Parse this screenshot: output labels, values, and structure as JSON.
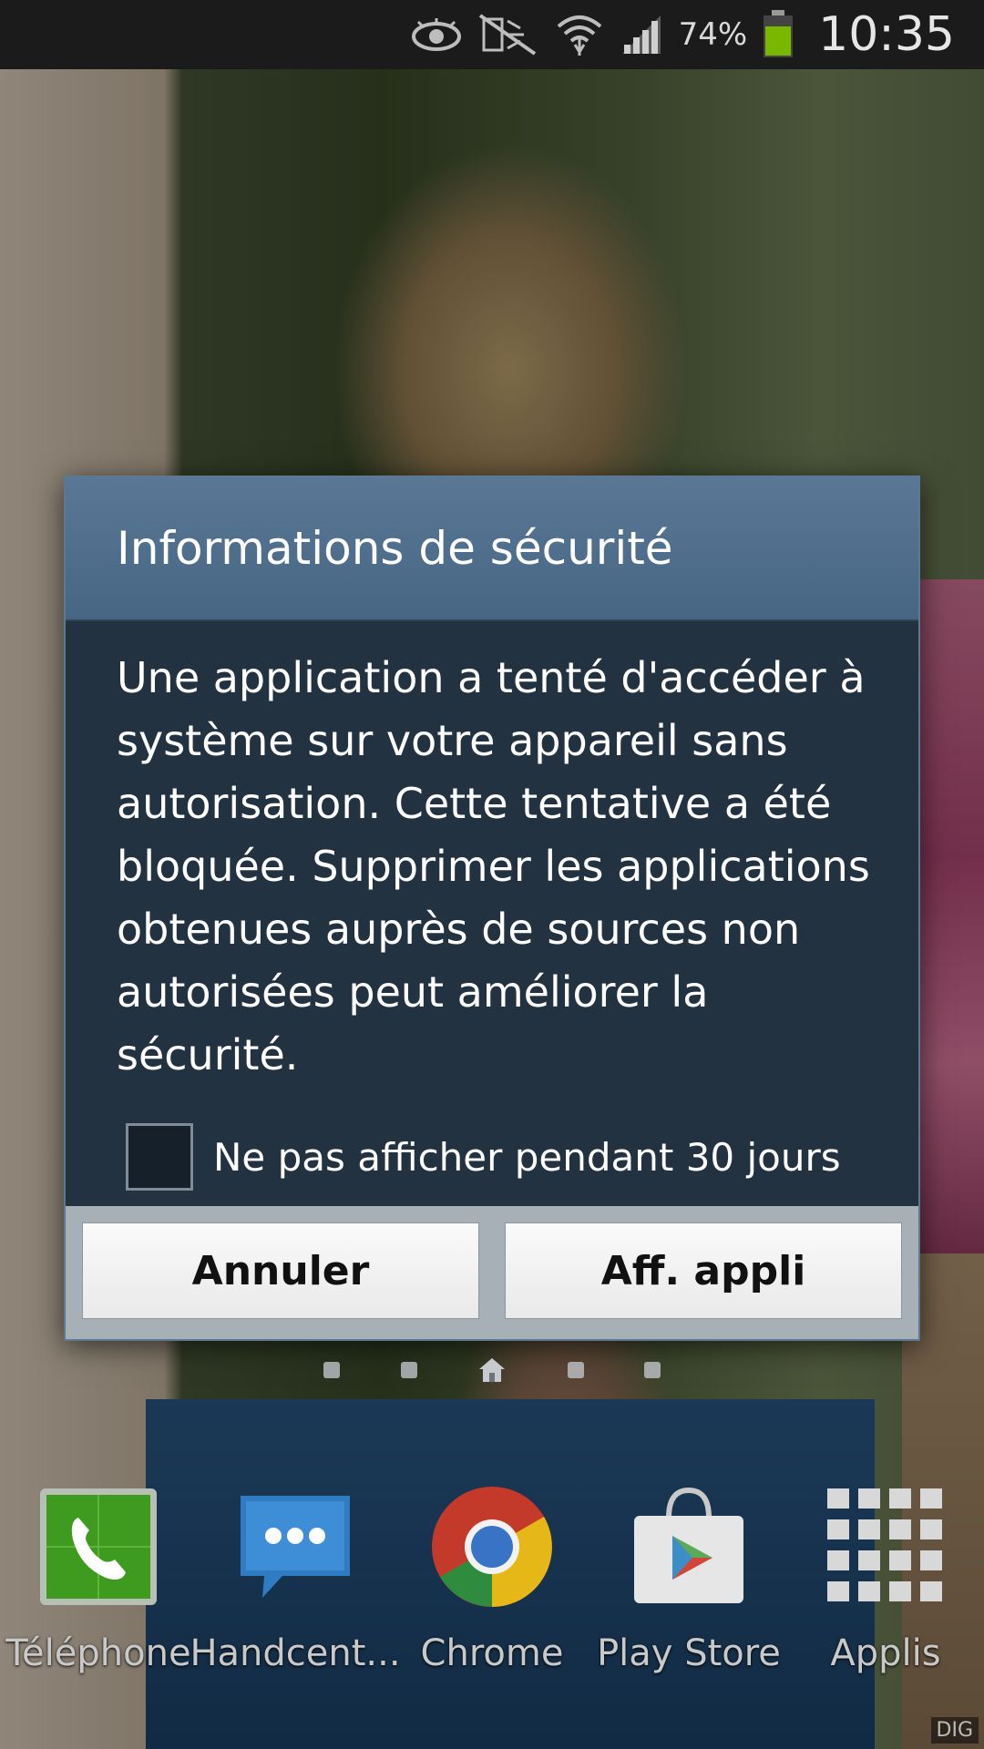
{
  "status_bar": {
    "battery_percent": "74%",
    "time": "10:35",
    "icons": [
      "eye-icon",
      "mute-icon",
      "wifi-icon",
      "signal-icon",
      "battery-icon"
    ],
    "battery_color": "#7ab800"
  },
  "dialog": {
    "title": "Informations de sécurité",
    "message": "Une application a tenté d'accéder à système sur votre appareil sans autorisation. Cette tentative a été bloquée. Supprimer les applications obtenues auprès de sources non autorisées peut améliorer la sécurité.",
    "checkbox_label": "Ne pas afficher pendant 30 jours",
    "checkbox_checked": false,
    "cancel_label": "Annuler",
    "confirm_label": "Aff. appli",
    "header_color": "#4b6a88",
    "body_color": "#233240"
  },
  "home": {
    "pages": 5,
    "current_page": 3
  },
  "dock": {
    "apps": [
      {
        "label": "Téléphone",
        "icon": "phone-icon"
      },
      {
        "label": "Handcent...",
        "icon": "messaging-icon"
      },
      {
        "label": "Chrome",
        "icon": "chrome-icon"
      },
      {
        "label": "Play Store",
        "icon": "play-store-icon"
      },
      {
        "label": "Applis",
        "icon": "apps-grid-icon"
      }
    ]
  },
  "watermark": "DIG"
}
